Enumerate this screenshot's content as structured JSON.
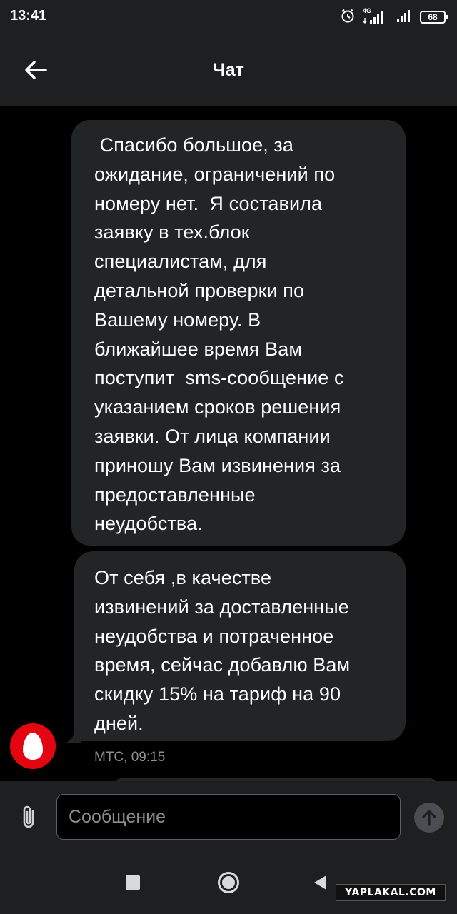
{
  "status_bar": {
    "time": "13:41",
    "network": "4G",
    "battery": "68"
  },
  "app_bar": {
    "title": "Чат"
  },
  "chat": {
    "messages": [
      {
        "text": " Спасибо большое, за\nожидание, ограничений по\nномеру нет.  Я составила\nзаявку в тех.блок\nспециалистам, для\nдетальной проверки по\nВашему номеру. В\nближайшее время Вам\nпоступит  sms-сообщение с\nуказанием сроков решения\nзаявки. От лица компании\nприношу Вам извинения за\nпредоставленные\nнеудобства."
      },
      {
        "text": "От себя ,в качестве\nизвинений за доставленные\nнеудобства и потраченное\nвремя, сейчас добавлю Вам\nскидку 15% на тариф на 90\nдней."
      }
    ],
    "meta": "МТС, 09:15"
  },
  "input": {
    "placeholder": "Сообщение",
    "value": ""
  },
  "watermark": "YAPLAKAL.COM",
  "colors": {
    "bar_bg": "#1e1f21",
    "bubble_bg": "#222426",
    "brand_red": "#e30611"
  }
}
